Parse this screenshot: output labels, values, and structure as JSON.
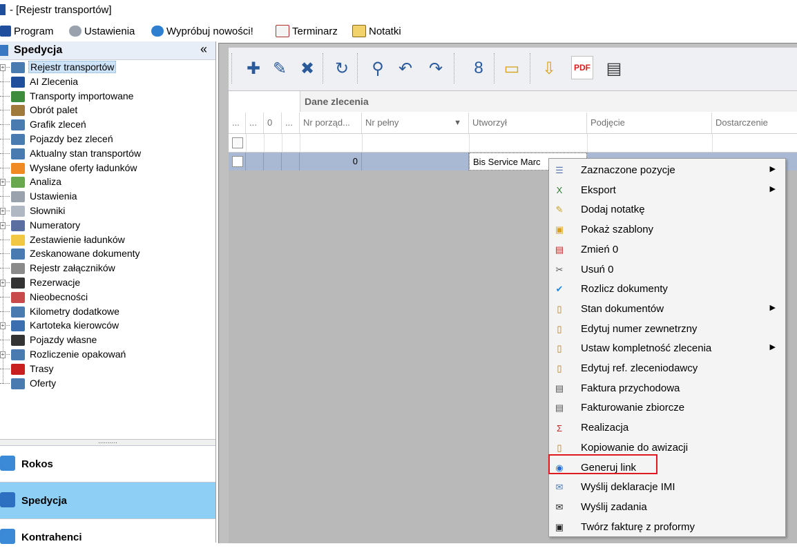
{
  "window": {
    "title": "- [Rejestr transportów]"
  },
  "menubar": [
    {
      "label": "Program",
      "icon": "program-icon"
    },
    {
      "label": "Ustawienia",
      "icon": "gear-icon"
    },
    {
      "label": "Wypróbuj nowości!",
      "icon": "globe-icon"
    },
    {
      "label": "Terminarz",
      "icon": "calendar-icon"
    },
    {
      "label": "Notatki",
      "icon": "notes-icon"
    }
  ],
  "sidebar": {
    "title": "Spedycja",
    "collapse_glyph": "«",
    "items": [
      {
        "label": "Rejestr transportów",
        "icon": "truck-icon",
        "selected": true,
        "expandable": true
      },
      {
        "label": "AI Zlecenia",
        "icon": "ai-icon"
      },
      {
        "label": "Transporty importowane",
        "icon": "truck-import-icon"
      },
      {
        "label": "Obrót palet",
        "icon": "pallet-icon"
      },
      {
        "label": "Grafik zleceń",
        "icon": "truck-icon"
      },
      {
        "label": "Pojazdy bez zleceń",
        "icon": "truck-icon"
      },
      {
        "label": "Aktualny stan transportów",
        "icon": "truck-icon"
      },
      {
        "label": "Wysłane oferty ładunków",
        "icon": "rss-icon"
      },
      {
        "label": "Analiza",
        "icon": "analysis-icon",
        "expandable": true
      },
      {
        "label": "Ustawienia",
        "icon": "gear-icon"
      },
      {
        "label": "Słowniki",
        "icon": "dictionary-icon",
        "expandable": true
      },
      {
        "label": "Numeratory",
        "icon": "numbers-icon",
        "expandable": true
      },
      {
        "label": "Zestawienie ładunków",
        "icon": "cargo-icon"
      },
      {
        "label": "Zeskanowane dokumenty",
        "icon": "truck-icon"
      },
      {
        "label": "Rejestr załączników",
        "icon": "paperclip-icon"
      },
      {
        "label": "Rezerwacje",
        "icon": "reservation-icon",
        "expandable": true
      },
      {
        "label": "Nieobecności",
        "icon": "calendar-icon"
      },
      {
        "label": "Kilometry dodatkowe",
        "icon": "truck-icon"
      },
      {
        "label": "Kartoteka kierowców",
        "icon": "driver-icon",
        "expandable": true
      },
      {
        "label": "Pojazdy własne",
        "icon": "vehicle-icon"
      },
      {
        "label": "Rozliczenie opakowań",
        "icon": "truck-icon",
        "expandable": true
      },
      {
        "label": "Trasy",
        "icon": "route-icon"
      },
      {
        "label": "Oferty",
        "icon": "truck-icon"
      }
    ],
    "splitter_glyph": "..........",
    "nav_buttons": [
      {
        "label": "Rokos",
        "icon": "rokos-icon",
        "active": false
      },
      {
        "label": "Spedycja",
        "icon": "spedycja-icon",
        "active": true
      },
      {
        "label": "Kontrahenci",
        "icon": "contractors-icon",
        "active": false
      }
    ]
  },
  "toolbar": {
    "buttons": [
      {
        "name": "add-button",
        "glyph": "✚"
      },
      {
        "name": "edit-button",
        "glyph": "✎"
      },
      {
        "name": "delete-button",
        "glyph": "✖"
      },
      {
        "name": "refresh-button",
        "glyph": "↻"
      },
      {
        "name": "details-button",
        "glyph": "⚲"
      },
      {
        "name": "undo-button",
        "glyph": "↶"
      },
      {
        "name": "redo-button",
        "glyph": "↷"
      },
      {
        "name": "eight-button",
        "glyph": "8"
      },
      {
        "name": "folder-button",
        "glyph": "▭"
      },
      {
        "name": "export-button",
        "glyph": "⇩"
      },
      {
        "name": "pdf-button",
        "glyph": "PDF"
      },
      {
        "name": "print-button",
        "glyph": "▤"
      }
    ]
  },
  "grid": {
    "band_header": "Dane zlecenia",
    "columns": [
      {
        "label": "..."
      },
      {
        "label": "..."
      },
      {
        "label": "0"
      },
      {
        "label": "..."
      },
      {
        "label": "Nr porząd..."
      },
      {
        "label": "Nr pełny",
        "sortable": true
      },
      {
        "label": "Utworzył"
      },
      {
        "label": "Podjęcie"
      },
      {
        "label": "Dostarczenie"
      }
    ],
    "sort_glyph": "▼",
    "rows": [
      {
        "nr_porzadkowy": "0",
        "nr_pelny": "",
        "utworzyl": "Bis Service Marc"
      }
    ]
  },
  "context_menu": {
    "items": [
      {
        "label": "Zaznaczone pozycje",
        "icon": "selected-items-icon",
        "submenu": true
      },
      {
        "label": "Eksport",
        "icon": "excel-icon",
        "submenu": true
      },
      {
        "label": "Dodaj notatkę",
        "icon": "note-icon",
        "submenu": false
      },
      {
        "label": "Pokaż szablony",
        "icon": "templates-icon",
        "submenu": false
      },
      {
        "label": "Zmień 0",
        "icon": "edit-icon",
        "submenu": false
      },
      {
        "label": "Usuń 0",
        "icon": "scissors-icon",
        "submenu": false
      },
      {
        "label": "Rozlicz dokumenty",
        "icon": "check-icon",
        "submenu": false
      },
      {
        "label": "Stan dokumentów",
        "icon": "clipboard-icon",
        "submenu": true
      },
      {
        "label": "Edytuj numer zewnetrzny",
        "icon": "clipboard-icon",
        "submenu": false
      },
      {
        "label": "Ustaw kompletność zlecenia",
        "icon": "clipboard-icon",
        "submenu": true
      },
      {
        "label": "Edytuj ref. zleceniodawcy",
        "icon": "clipboard-icon",
        "submenu": false
      },
      {
        "label": "Faktura przychodowa",
        "icon": "document-icon",
        "submenu": false
      },
      {
        "label": "Fakturowanie zbiorcze",
        "icon": "document-icon",
        "submenu": false
      },
      {
        "label": "Realizacja",
        "icon": "realization-icon",
        "submenu": false
      },
      {
        "label": "Kopiowanie do awizacji",
        "icon": "clipboard-icon",
        "submenu": false
      },
      {
        "label": "Generuj link",
        "icon": "globe-icon",
        "submenu": false,
        "highlighted": true
      },
      {
        "label": "Wyślij deklaracje IMI",
        "icon": "envelope-icon",
        "submenu": false
      },
      {
        "label": "Wyślij zadania",
        "icon": "mail-circle-icon",
        "submenu": false
      },
      {
        "label": "Twórz fakturę z proformy",
        "icon": "invoice-icon",
        "submenu": false
      }
    ],
    "submenu_glyph": "▶",
    "highlight_color": "#e0191f"
  }
}
